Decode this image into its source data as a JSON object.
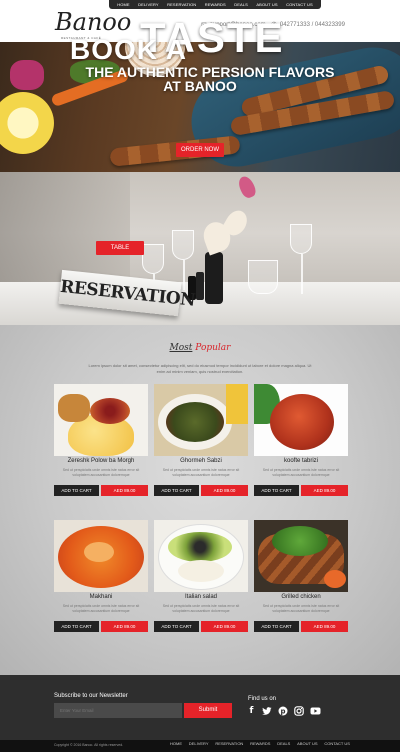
{
  "nav": {
    "items": [
      "HOME",
      "DELIVERY",
      "RESERVATION",
      "REWARDS",
      "DEALS",
      "ABOUT US",
      "CONTACT US"
    ]
  },
  "logo": {
    "text": "Banoo",
    "tagline": "RESTAURANT & CAFÉ"
  },
  "contact": {
    "email": "support@banoo.com",
    "phone": "042771333 / 044323399"
  },
  "hero": {
    "title": "TASTE",
    "subtitle": "THE AUTHENTIC PERSION FLAVORS",
    "subtitle2": "AT BANOO",
    "button": "ORDER NOW"
  },
  "booking": {
    "title": "BOOK A",
    "button": "TABLE",
    "sign": "RESERVATION"
  },
  "popular": {
    "title_a": "Most",
    "title_b": "Popular",
    "description": "Lorem ipsum dolor sit amet, consectetur adipiscing elit, sed do eiusmod tempor incididunt ut labore et dolore magna aliqua. Ut enim ad minim veniam, quis nostrud exercitation.",
    "cart_label": "ADD TO CART",
    "item_desc": "Sed ut perspiciatis unde omnis iste natus error sit voluptatem accusantium doloremque",
    "items": [
      {
        "name": "Zereshk Polow ba Morgh",
        "price": "AED 89.00"
      },
      {
        "name": "Ghormeh Sabzi",
        "price": "AED 89.00"
      },
      {
        "name": "koofte tabrizi",
        "price": "AED 89.00"
      },
      {
        "name": "Makhani",
        "price": "AED 89.00"
      },
      {
        "name": "Italian salad",
        "price": "AED 89.00"
      },
      {
        "name": "Grilled chicken",
        "price": "AED 89.00"
      }
    ]
  },
  "footer": {
    "newsletter_label": "Subscribe to our Newsletter",
    "email_placeholder": "Enter Your Email",
    "submit": "Submit",
    "find_us": "Find us on",
    "social": [
      "facebook-icon",
      "twitter-icon",
      "pinterest-icon",
      "instagram-icon",
      "youtube-icon"
    ],
    "copyright": "Copyright © 2016 Banoo. All rights reserved.",
    "nav": [
      "HOME",
      "DELIVERY",
      "RESERVATION",
      "REWARDS",
      "DEALS",
      "ABOUT US",
      "CONTACT US"
    ]
  },
  "colors": {
    "accent": "#e52329",
    "dark": "#222222",
    "footer": "#2e2e2e"
  }
}
